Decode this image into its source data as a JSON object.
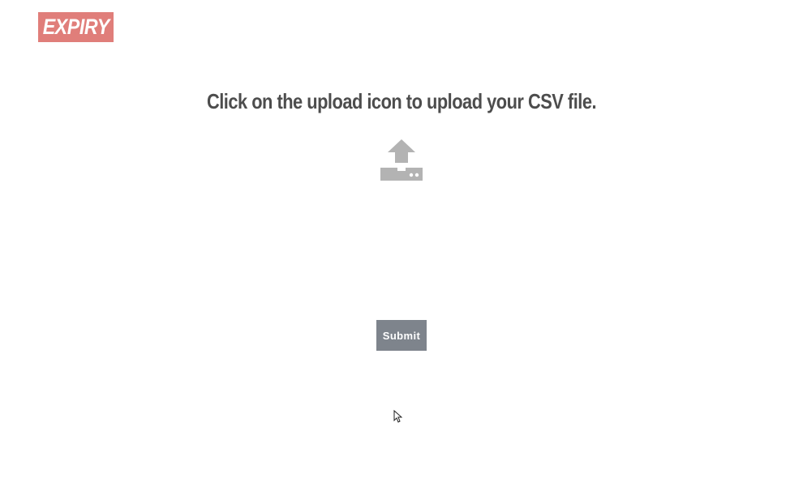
{
  "app": {
    "logo_text": "EXPIRY",
    "logo_color": "#e07e7a"
  },
  "upload": {
    "instruction": "Click on the upload icon to upload your CSV file.",
    "icon": "upload-icon",
    "icon_color": "#b3b3b3"
  },
  "form": {
    "submit_label": "Submit",
    "submit_color": "#7e848c"
  }
}
